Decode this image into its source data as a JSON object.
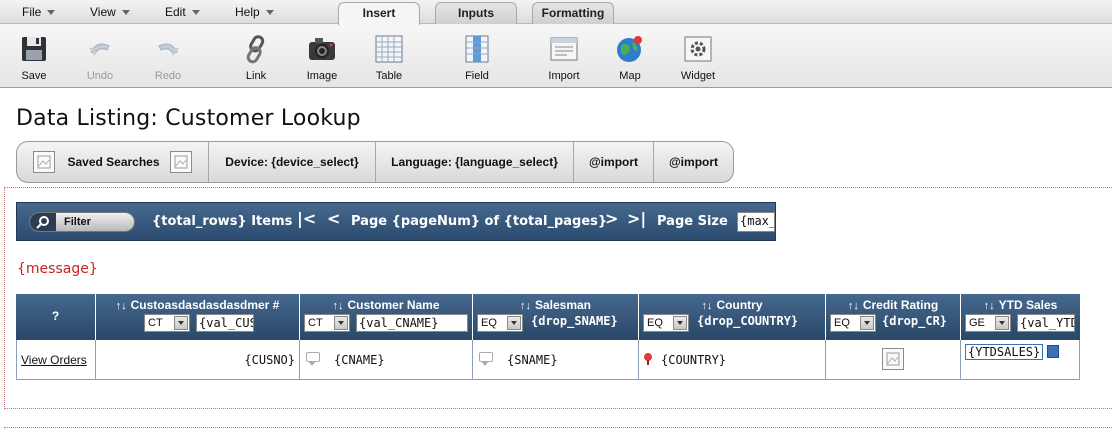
{
  "menu": [
    "File",
    "View",
    "Edit",
    "Help"
  ],
  "tabs": [
    "Insert",
    "Inputs",
    "Formatting"
  ],
  "active_tab": "Insert",
  "ribbon": {
    "save": "Save",
    "undo": "Undo",
    "redo": "Redo",
    "link": "Link",
    "image": "Image",
    "table": "Table",
    "field": "Field",
    "import": "Import",
    "map": "Map",
    "widget": "Widget"
  },
  "page_title": "Data Listing: Customer Lookup",
  "toolbar": {
    "saved_searches": "Saved Searches",
    "device": "Device: {device_select}",
    "language": "Language: {language_select}",
    "import1": "@import",
    "import2": "@import"
  },
  "filter_bar": {
    "filter_label": "Filter",
    "items": "{total_rows} Items",
    "first": "|<",
    "prev": "<",
    "page_text": "Page {pageNum} of {total_pages}",
    "next": ">",
    "last": ">|",
    "page_size_label": "Page Size",
    "page_size_value": "{max_"
  },
  "message": "{message}",
  "table": {
    "sort_glyph": "↑↓",
    "headers": [
      {
        "title": "?",
        "op": "",
        "value": ""
      },
      {
        "title": "Custoasdasdasdasdmer #",
        "op": "CT",
        "value": "{val_CUS"
      },
      {
        "title": "Customer Name",
        "op": "CT",
        "value": "{val_CNAME}"
      },
      {
        "title": "Salesman",
        "op": "EQ",
        "value": "{drop_SNAME}"
      },
      {
        "title": "Country",
        "op": "EQ",
        "value": "{drop_COUNTRY}"
      },
      {
        "title": "Credit Rating",
        "op": "EQ",
        "value": "{drop_CR}"
      },
      {
        "title": "YTD Sales",
        "op": "GE",
        "value": "{val_YTD"
      }
    ],
    "row": {
      "link": "View Orders",
      "cusno": "{CUSNO}",
      "cname": "{CNAME}",
      "sname": "{SNAME}",
      "country": "{COUNTRY}",
      "ytdsales": "{YTDSALES}"
    }
  }
}
